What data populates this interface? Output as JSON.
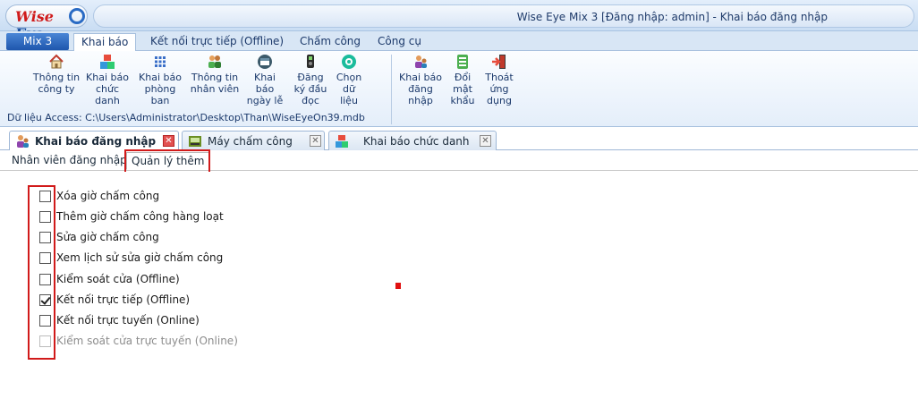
{
  "window": {
    "logo": {
      "text_red": "Wise",
      "text_blue": "Eye"
    },
    "title": "Wise Eye Mix 3 [Đăng nhập: admin] - Khai báo đăng nhập"
  },
  "menu": {
    "app_button": "Mix 3",
    "tabs": [
      "Khai báo",
      "Kết nối trực tiếp (Offline)",
      "Chấm công",
      "Công cụ"
    ],
    "active_tab": "Khai báo"
  },
  "ribbon": {
    "buttons": [
      {
        "label": "Thông tin công ty",
        "icon": "house-icon"
      },
      {
        "label": "Khai báo chức danh",
        "icon": "abc-blocks-icon"
      },
      {
        "label": "Khai báo phòng ban",
        "icon": "grid-icon"
      },
      {
        "label": "Thông tin nhân viên",
        "icon": "people-icon"
      },
      {
        "label": "Khai báo ngày lễ",
        "icon": "calendar-icon"
      },
      {
        "label": "Đăng ký đầu đọc",
        "icon": "reader-device-icon"
      },
      {
        "label": "Chọn dữ liệu",
        "icon": "data-select-icon"
      },
      {
        "label": "Khai báo đăng nhập",
        "icon": "login-users-icon"
      },
      {
        "label": "Đổi mật khẩu",
        "icon": "password-icon"
      },
      {
        "label": "Thoát ứng dụng",
        "icon": "exit-icon"
      }
    ],
    "data_source": "Dữ liệu Access: C:\\Users\\Administrator\\Desktop\\Than\\WiseEyeOn39.mdb"
  },
  "document_tabs": [
    {
      "label": "Khai báo đăng nhập",
      "icon": "login-users-icon",
      "active": true
    },
    {
      "label": "Máy chấm công",
      "icon": "time-clock-icon",
      "active": false
    },
    {
      "label": "Khai báo chức danh",
      "icon": "abc-blocks-icon",
      "active": false
    }
  ],
  "sub_tabs": {
    "items": [
      "Nhân viên đăng nhập",
      "Quản lý thêm"
    ],
    "active": "Quản lý thêm"
  },
  "permissions": [
    {
      "label": "Xóa giờ chấm công",
      "checked": false,
      "enabled": true
    },
    {
      "label": "Thêm giờ chấm công hàng loạt",
      "checked": false,
      "enabled": true
    },
    {
      "label": "Sửa giờ chấm công",
      "checked": false,
      "enabled": true
    },
    {
      "label": "Xem lịch sử sửa giờ chấm công",
      "checked": false,
      "enabled": true
    },
    {
      "label": "Kiểm soát cửa (Offline)",
      "checked": false,
      "enabled": true
    },
    {
      "label": "Kết nối trực tiếp (Offline)",
      "checked": true,
      "enabled": true
    },
    {
      "label": "Kết nối trực tuyến (Online)",
      "checked": false,
      "enabled": true
    },
    {
      "label": "Kiểm soát cửa trực tuyến (Online)",
      "checked": false,
      "enabled": false
    }
  ],
  "colors": {
    "highlight": "#d11a1a",
    "accent": "#1e56ad"
  }
}
